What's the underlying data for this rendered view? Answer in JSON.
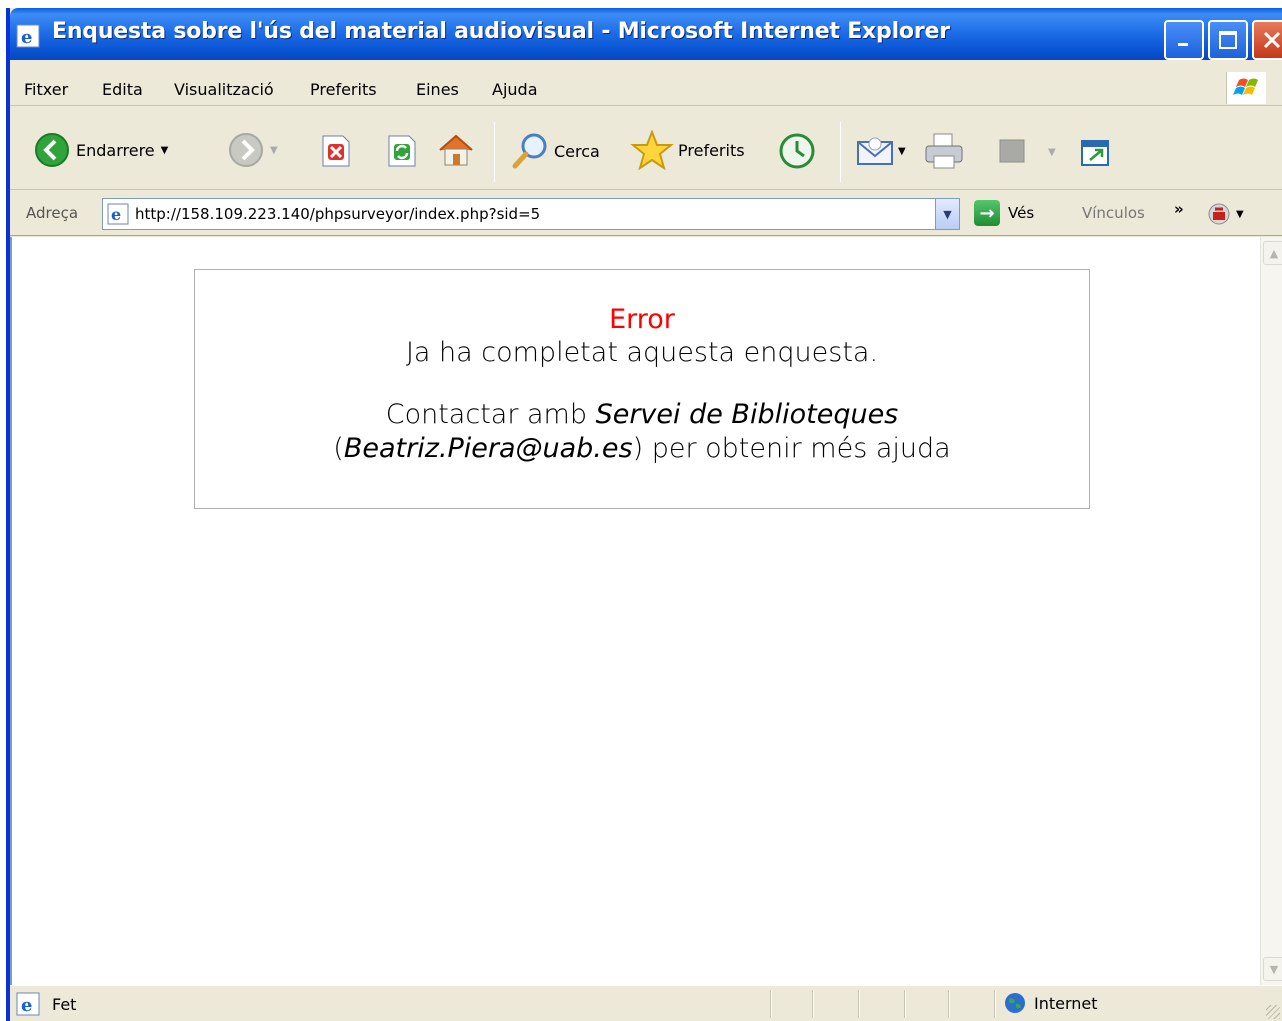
{
  "window": {
    "title": "Enquesta sobre l'ús del material audiovisual - Microsoft Internet Explorer"
  },
  "menu": {
    "items": [
      {
        "label": "Fitxer"
      },
      {
        "label": "Edita"
      },
      {
        "label": "Visualització"
      },
      {
        "label": "Preferits"
      },
      {
        "label": "Eines"
      },
      {
        "label": "Ajuda"
      }
    ]
  },
  "toolbar": {
    "back_label": "Endarrere",
    "search_label": "Cerca",
    "favorites_label": "Preferits"
  },
  "address": {
    "label": "Adreça",
    "url": "http://158.109.223.140/phpsurveyor/index.php?sid=5",
    "go_label": "Vés",
    "links_label": "Vínculos",
    "links_chevron": "»"
  },
  "page": {
    "error_title": "Error",
    "error_message": "Ja ha completat aquesta enquesta.",
    "contact_prefix": "Contactar amb ",
    "contact_name": "Servei de Biblioteques",
    "contact_open": "(",
    "contact_email": "Beatriz.Piera@uab.es",
    "contact_suffix": ") per obtenir més ajuda"
  },
  "status": {
    "text": "Fet",
    "zone": "Internet"
  },
  "colors": {
    "error": "#ff0000",
    "titlebar": "#0a55d4"
  }
}
